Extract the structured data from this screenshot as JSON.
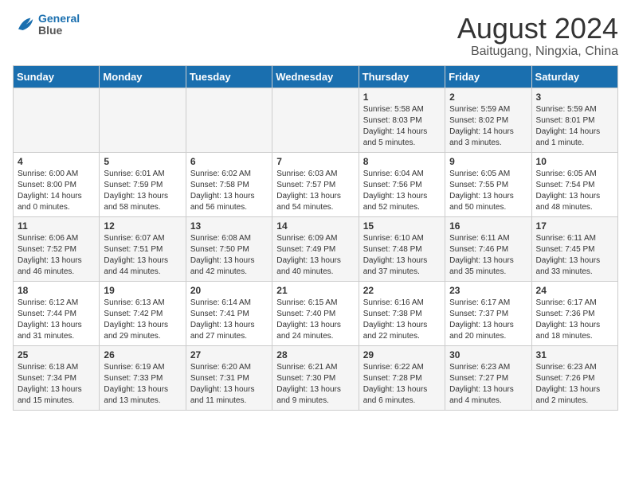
{
  "header": {
    "logo_line1": "General",
    "logo_line2": "Blue",
    "month": "August 2024",
    "location": "Baitugang, Ningxia, China"
  },
  "weekdays": [
    "Sunday",
    "Monday",
    "Tuesday",
    "Wednesday",
    "Thursday",
    "Friday",
    "Saturday"
  ],
  "weeks": [
    [
      {
        "day": "",
        "info": ""
      },
      {
        "day": "",
        "info": ""
      },
      {
        "day": "",
        "info": ""
      },
      {
        "day": "",
        "info": ""
      },
      {
        "day": "1",
        "info": "Sunrise: 5:58 AM\nSunset: 8:03 PM\nDaylight: 14 hours\nand 5 minutes."
      },
      {
        "day": "2",
        "info": "Sunrise: 5:59 AM\nSunset: 8:02 PM\nDaylight: 14 hours\nand 3 minutes."
      },
      {
        "day": "3",
        "info": "Sunrise: 5:59 AM\nSunset: 8:01 PM\nDaylight: 14 hours\nand 1 minute."
      }
    ],
    [
      {
        "day": "4",
        "info": "Sunrise: 6:00 AM\nSunset: 8:00 PM\nDaylight: 14 hours\nand 0 minutes."
      },
      {
        "day": "5",
        "info": "Sunrise: 6:01 AM\nSunset: 7:59 PM\nDaylight: 13 hours\nand 58 minutes."
      },
      {
        "day": "6",
        "info": "Sunrise: 6:02 AM\nSunset: 7:58 PM\nDaylight: 13 hours\nand 56 minutes."
      },
      {
        "day": "7",
        "info": "Sunrise: 6:03 AM\nSunset: 7:57 PM\nDaylight: 13 hours\nand 54 minutes."
      },
      {
        "day": "8",
        "info": "Sunrise: 6:04 AM\nSunset: 7:56 PM\nDaylight: 13 hours\nand 52 minutes."
      },
      {
        "day": "9",
        "info": "Sunrise: 6:05 AM\nSunset: 7:55 PM\nDaylight: 13 hours\nand 50 minutes."
      },
      {
        "day": "10",
        "info": "Sunrise: 6:05 AM\nSunset: 7:54 PM\nDaylight: 13 hours\nand 48 minutes."
      }
    ],
    [
      {
        "day": "11",
        "info": "Sunrise: 6:06 AM\nSunset: 7:52 PM\nDaylight: 13 hours\nand 46 minutes."
      },
      {
        "day": "12",
        "info": "Sunrise: 6:07 AM\nSunset: 7:51 PM\nDaylight: 13 hours\nand 44 minutes."
      },
      {
        "day": "13",
        "info": "Sunrise: 6:08 AM\nSunset: 7:50 PM\nDaylight: 13 hours\nand 42 minutes."
      },
      {
        "day": "14",
        "info": "Sunrise: 6:09 AM\nSunset: 7:49 PM\nDaylight: 13 hours\nand 40 minutes."
      },
      {
        "day": "15",
        "info": "Sunrise: 6:10 AM\nSunset: 7:48 PM\nDaylight: 13 hours\nand 37 minutes."
      },
      {
        "day": "16",
        "info": "Sunrise: 6:11 AM\nSunset: 7:46 PM\nDaylight: 13 hours\nand 35 minutes."
      },
      {
        "day": "17",
        "info": "Sunrise: 6:11 AM\nSunset: 7:45 PM\nDaylight: 13 hours\nand 33 minutes."
      }
    ],
    [
      {
        "day": "18",
        "info": "Sunrise: 6:12 AM\nSunset: 7:44 PM\nDaylight: 13 hours\nand 31 minutes."
      },
      {
        "day": "19",
        "info": "Sunrise: 6:13 AM\nSunset: 7:42 PM\nDaylight: 13 hours\nand 29 minutes."
      },
      {
        "day": "20",
        "info": "Sunrise: 6:14 AM\nSunset: 7:41 PM\nDaylight: 13 hours\nand 27 minutes."
      },
      {
        "day": "21",
        "info": "Sunrise: 6:15 AM\nSunset: 7:40 PM\nDaylight: 13 hours\nand 24 minutes."
      },
      {
        "day": "22",
        "info": "Sunrise: 6:16 AM\nSunset: 7:38 PM\nDaylight: 13 hours\nand 22 minutes."
      },
      {
        "day": "23",
        "info": "Sunrise: 6:17 AM\nSunset: 7:37 PM\nDaylight: 13 hours\nand 20 minutes."
      },
      {
        "day": "24",
        "info": "Sunrise: 6:17 AM\nSunset: 7:36 PM\nDaylight: 13 hours\nand 18 minutes."
      }
    ],
    [
      {
        "day": "25",
        "info": "Sunrise: 6:18 AM\nSunset: 7:34 PM\nDaylight: 13 hours\nand 15 minutes."
      },
      {
        "day": "26",
        "info": "Sunrise: 6:19 AM\nSunset: 7:33 PM\nDaylight: 13 hours\nand 13 minutes."
      },
      {
        "day": "27",
        "info": "Sunrise: 6:20 AM\nSunset: 7:31 PM\nDaylight: 13 hours\nand 11 minutes."
      },
      {
        "day": "28",
        "info": "Sunrise: 6:21 AM\nSunset: 7:30 PM\nDaylight: 13 hours\nand 9 minutes."
      },
      {
        "day": "29",
        "info": "Sunrise: 6:22 AM\nSunset: 7:28 PM\nDaylight: 13 hours\nand 6 minutes."
      },
      {
        "day": "30",
        "info": "Sunrise: 6:23 AM\nSunset: 7:27 PM\nDaylight: 13 hours\nand 4 minutes."
      },
      {
        "day": "31",
        "info": "Sunrise: 6:23 AM\nSunset: 7:26 PM\nDaylight: 13 hours\nand 2 minutes."
      }
    ]
  ]
}
